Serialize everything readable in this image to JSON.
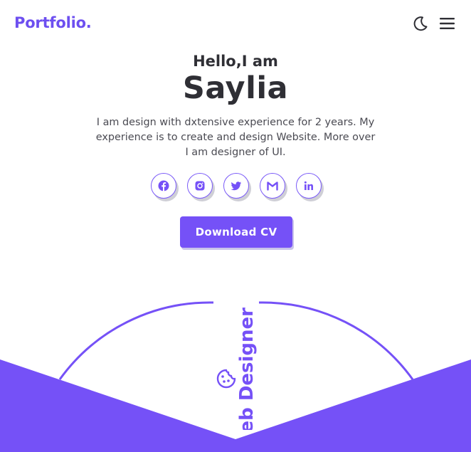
{
  "header": {
    "logo": "Portfolio.",
    "theme_toggle_icon": "moon-icon",
    "menu_icon": "hamburger-menu-icon"
  },
  "hero": {
    "greeting": "Hello,I am",
    "name": "Saylia",
    "description": "I am design with dxtensive experience for 2 years. My experience is to create and design Website. More over I am designer of UI.",
    "download_label": "Download CV"
  },
  "socials": [
    {
      "name": "facebook",
      "icon": "facebook-icon"
    },
    {
      "name": "instagram",
      "icon": "instagram-icon"
    },
    {
      "name": "twitter",
      "icon": "twitter-icon"
    },
    {
      "name": "gmail",
      "icon": "gmail-icon"
    },
    {
      "name": "linkedin",
      "icon": "linkedin-icon"
    }
  ],
  "decoration": {
    "vertical_text": "Web Designer",
    "vertical_icon": "cookie-icon"
  },
  "colors": {
    "accent": "#7551f7",
    "logo": "#6d4ff0",
    "text": "#2f2f35",
    "background": "#ffffff"
  }
}
